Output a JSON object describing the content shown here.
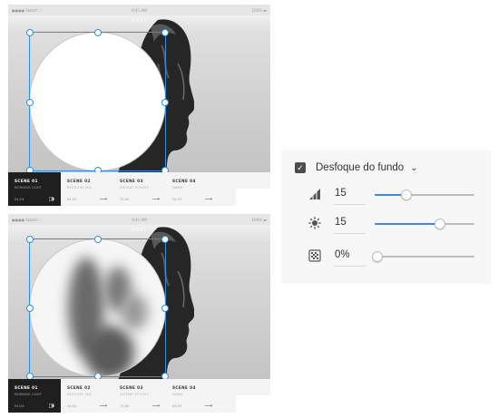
{
  "mockups": [
    {
      "status": {
        "carrier": "●●●● Sketch ⌔",
        "time": "9:41 AM",
        "battery": "100% ▬"
      },
      "app_title": "ODEL",
      "scenes": [
        {
          "title": "SCENE 01",
          "subtitle": "MORNING LIGHT",
          "duration": "04:24",
          "action": "▯◗"
        },
        {
          "title": "SCENE 02",
          "subtitle": "RESTLESS SEA",
          "duration": "04:45",
          "action": "⟶"
        },
        {
          "title": "SCENE 03",
          "subtitle": "DISTANT ECHOES",
          "duration": "13:40",
          "action": "⟶"
        },
        {
          "title": "SCENE 04",
          "subtitle": "DAWN",
          "duration": "04:23",
          "action": "⟶"
        }
      ],
      "circle_state": "solid"
    },
    {
      "status": {
        "carrier": "●●●● Sketch ⌔",
        "time": "9:41 AM",
        "battery": "100% ▬"
      },
      "app_title": "ODEL",
      "scenes": [
        {
          "title": "SCENE 01",
          "subtitle": "MORNING LIGHT",
          "duration": "04:24",
          "action": "▯◗"
        },
        {
          "title": "SCENE 02",
          "subtitle": "RESTLESS SEA",
          "duration": "04:45",
          "action": "⟶"
        },
        {
          "title": "SCENE 03",
          "subtitle": "DISTANT ECHOES",
          "duration": "13:40",
          "action": "⟶"
        },
        {
          "title": "SCENE 04",
          "subtitle": "DAWN",
          "duration": "04:25",
          "action": "⟶"
        }
      ],
      "circle_state": "background-blur"
    }
  ],
  "blur_panel": {
    "enabled": true,
    "title": "Desfoque do fundo",
    "chevron_icon": "chevron-down-icon",
    "rows": [
      {
        "icon": "blur-amount-icon",
        "value": "15",
        "slider_fraction": 0.32
      },
      {
        "icon": "brightness-icon",
        "value": "15",
        "slider_fraction": 0.65
      },
      {
        "icon": "noise-icon",
        "value": "0%",
        "slider_fraction": 0.0
      }
    ],
    "accent_color": "#2f8ee6"
  }
}
